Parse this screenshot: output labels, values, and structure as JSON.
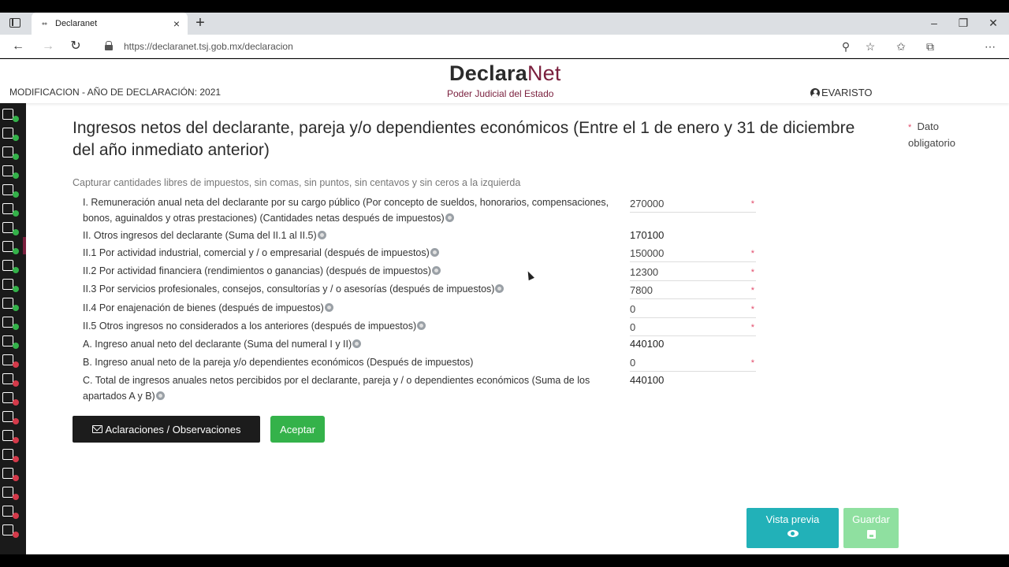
{
  "browser": {
    "tab_title": "Declaranet",
    "url": "https://declaranet.tsj.gob.mx/declaracion"
  },
  "header": {
    "mod_line": "MODIFICACION - AÑO DE DECLARACIÓN: 2021",
    "brand_main": "Declara",
    "brand_net": "Net",
    "brand_sub": "Poder Judicial del Estado",
    "user": "EVARISTO"
  },
  "form": {
    "title": "Ingresos netos del declarante, pareja y/o dependientes económicos (Entre el 1 de enero y 31 de diciembre del año inmediato anterior)",
    "legend_star": "*",
    "legend_text": "Dato obligatorio",
    "hint": "Capturar cantidades libres de impuestos, sin comas, sin puntos, sin centavos y sin ceros a la izquierda",
    "rows": [
      {
        "label": "I. Remuneración anual neta del declarante por su cargo público (Por concepto de sueldos, honorarios, compensaciones, bonos, aguinaldos y otras prestaciones) (Cantidades netas después de impuestos)",
        "value": "270000",
        "required": "*"
      },
      {
        "label": "II. Otros ingresos del declarante (Suma del II.1 al II.5)",
        "value": "170100"
      },
      {
        "label": "II.1 Por actividad industrial, comercial y / o empresarial (después de impuestos)",
        "value": "150000",
        "required": "*"
      },
      {
        "label": "II.2 Por actividad financiera (rendimientos o ganancias) (después de impuestos)",
        "value": "12300",
        "required": "*"
      },
      {
        "label": "II.3 Por servicios profesionales, consejos, consultorías y / o asesorías (después de impuestos)",
        "value": "7800",
        "required": "*"
      },
      {
        "label": "II.4 Por enajenación de bienes (después de impuestos)",
        "value": "0",
        "required": "*"
      },
      {
        "label": "II.5 Otros ingresos no considerados a los anteriores (después de impuestos)",
        "value": "0",
        "required": "*"
      },
      {
        "label": "A. Ingreso anual neto del declarante (Suma del numeral I y II)",
        "value": "440100"
      },
      {
        "label": "B. Ingreso anual neto de la pareja y/o dependientes económicos (Después de impuestos)",
        "value": "0",
        "required": "*"
      },
      {
        "label": "C. Total de ingresos anuales netos percibidos por el declarante, pareja y / o dependientes económicos (Suma de los apartados A y B)",
        "value": "440100"
      }
    ],
    "btn_aclaraciones": "Aclaraciones / Observaciones",
    "btn_aceptar": "Aceptar",
    "btn_vista_previa": "Vista previa",
    "btn_guardar": "Guardar"
  },
  "colors": {
    "brand": "#7a1f3d",
    "accept": "#34b24a",
    "preview": "#22b1b8",
    "save": "#8fe0a0",
    "required": "#e24a6a"
  }
}
